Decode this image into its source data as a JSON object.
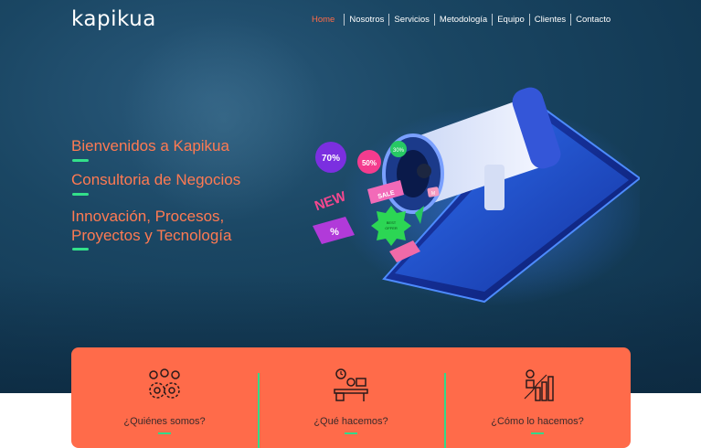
{
  "brand": {
    "logo_text": "kapikua"
  },
  "nav": {
    "items": [
      {
        "label": "Home",
        "active": true
      },
      {
        "label": "Nosotros"
      },
      {
        "label": "Servicios"
      },
      {
        "label": "Metodología"
      },
      {
        "label": "Equipo"
      },
      {
        "label": "Clientes"
      },
      {
        "label": "Contacto"
      }
    ]
  },
  "hero": {
    "lines": {
      "welcome": "Bienvenidos a Kapikua",
      "consulting": "Consultoria de Negocios",
      "innovation_1": "Innovación, Procesos,",
      "innovation_2": "Proyectos y Tecnología"
    },
    "illustration": {
      "tags": {
        "pct70": "70%",
        "pct50": "50%",
        "pct30": "30%",
        "sale": "SALE",
        "new": "NEW",
        "pct": "%",
        "best": "BEST",
        "offer": "OFFER",
        "m": "M"
      }
    }
  },
  "cards": [
    {
      "label": "¿Quiénes somos?",
      "icon": "team-gears-icon"
    },
    {
      "label": "¿Qué hacemos?",
      "icon": "desk-worker-icon"
    },
    {
      "label": "¿Cómo lo hacemos?",
      "icon": "growth-chart-icon"
    }
  ],
  "colors": {
    "accent": "#ff6b47",
    "green": "#33e08a",
    "hero_bg": "#133a55",
    "card_bg": "#ff6b4a"
  }
}
